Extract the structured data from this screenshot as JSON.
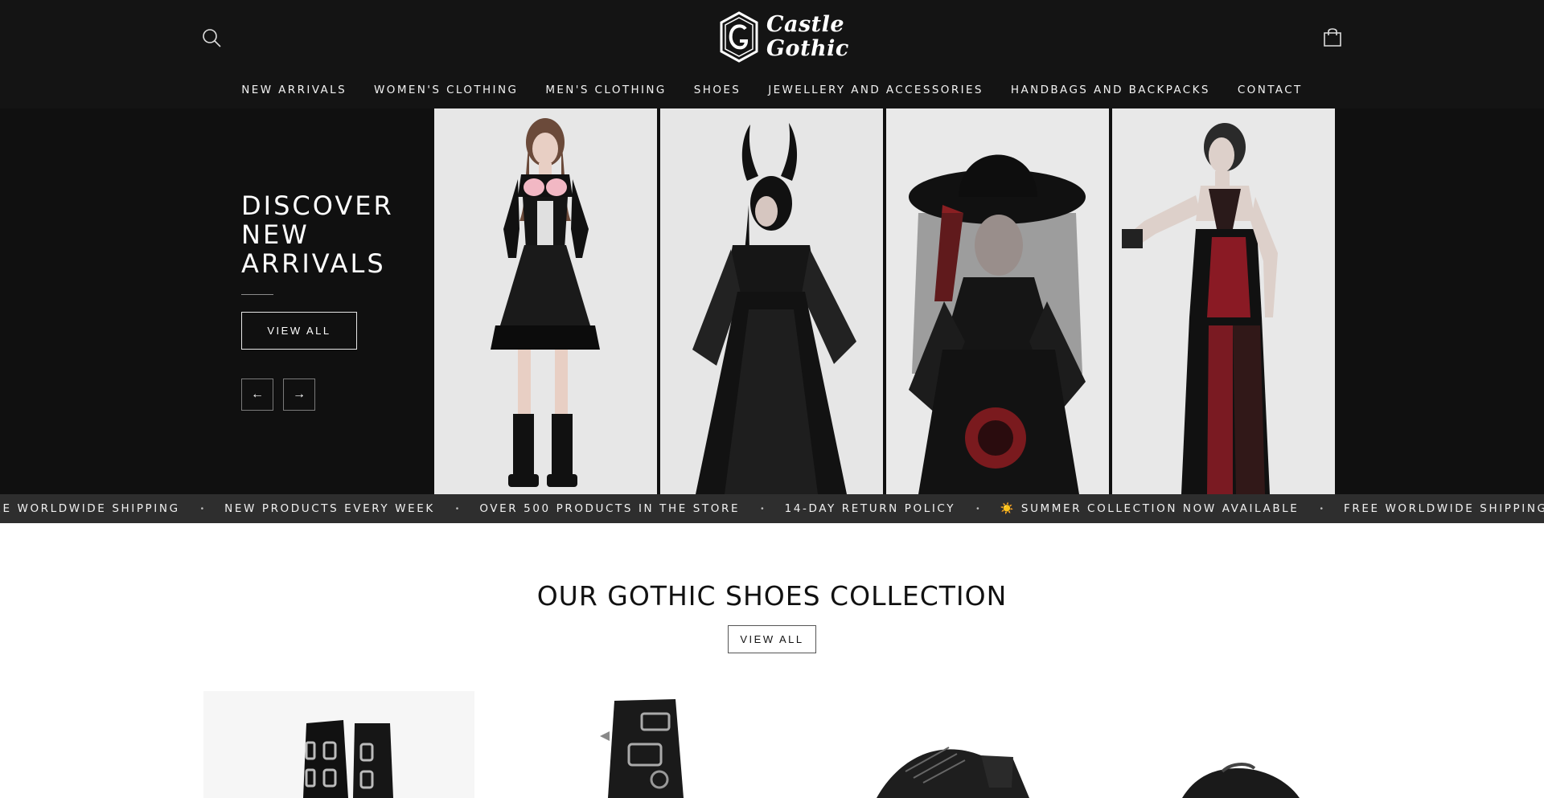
{
  "header": {
    "logo_line1": "Castle",
    "logo_line2": "Gothic",
    "logo_alt": "Castle Gothic logo",
    "background": "#141414"
  },
  "nav": {
    "items": [
      {
        "label": "NEW ARRIVALS"
      },
      {
        "label": "WOMEN'S CLOTHING"
      },
      {
        "label": "MEN'S CLOTHING"
      },
      {
        "label": "SHOES"
      },
      {
        "label": "JEWELLERY AND ACCESSORIES"
      },
      {
        "label": "HANDBAGS AND BACKPACKS"
      },
      {
        "label": "CONTACT"
      }
    ]
  },
  "hero": {
    "title_line1": "DISCOVER",
    "title_line2": "NEW",
    "title_line3": "ARRIVALS",
    "view_all": "VIEW ALL",
    "prev_arrow": "←",
    "next_arrow": "→",
    "panels": [
      {
        "name": "model-pink-corset-dress"
      },
      {
        "name": "model-horned-lace-gown"
      },
      {
        "name": "model-veiled-hat-dress"
      },
      {
        "name": "model-red-velvet-dress"
      }
    ]
  },
  "ticker": {
    "items": [
      {
        "text": "FREE WORLDWIDE SHIPPING"
      },
      {
        "text": "NEW PRODUCTS EVERY WEEK"
      },
      {
        "text": "OVER 500 PRODUCTS IN THE STORE"
      },
      {
        "text": "14-DAY RETURN POLICY"
      },
      {
        "text": "☀️ SUMMER COLLECTION NOW AVAILABLE"
      },
      {
        "text": "FREE WORLDWIDE SHIPPING"
      }
    ],
    "separator": "•"
  },
  "shoes": {
    "title": "OUR GOTHIC SHOES COLLECTION",
    "view_all": "VIEW ALL",
    "products": [
      {
        "name": "buckle-platform-boots"
      },
      {
        "name": "spiked-strap-boot"
      },
      {
        "name": "lace-up-platform-shoe"
      },
      {
        "name": "chunky-platform-shoe"
      }
    ]
  },
  "colors": {
    "header_bg": "#141414",
    "hero_bg": "#101010",
    "ticker_bg": "#2e2e2e",
    "panel_bg": "#e6e6e6"
  }
}
